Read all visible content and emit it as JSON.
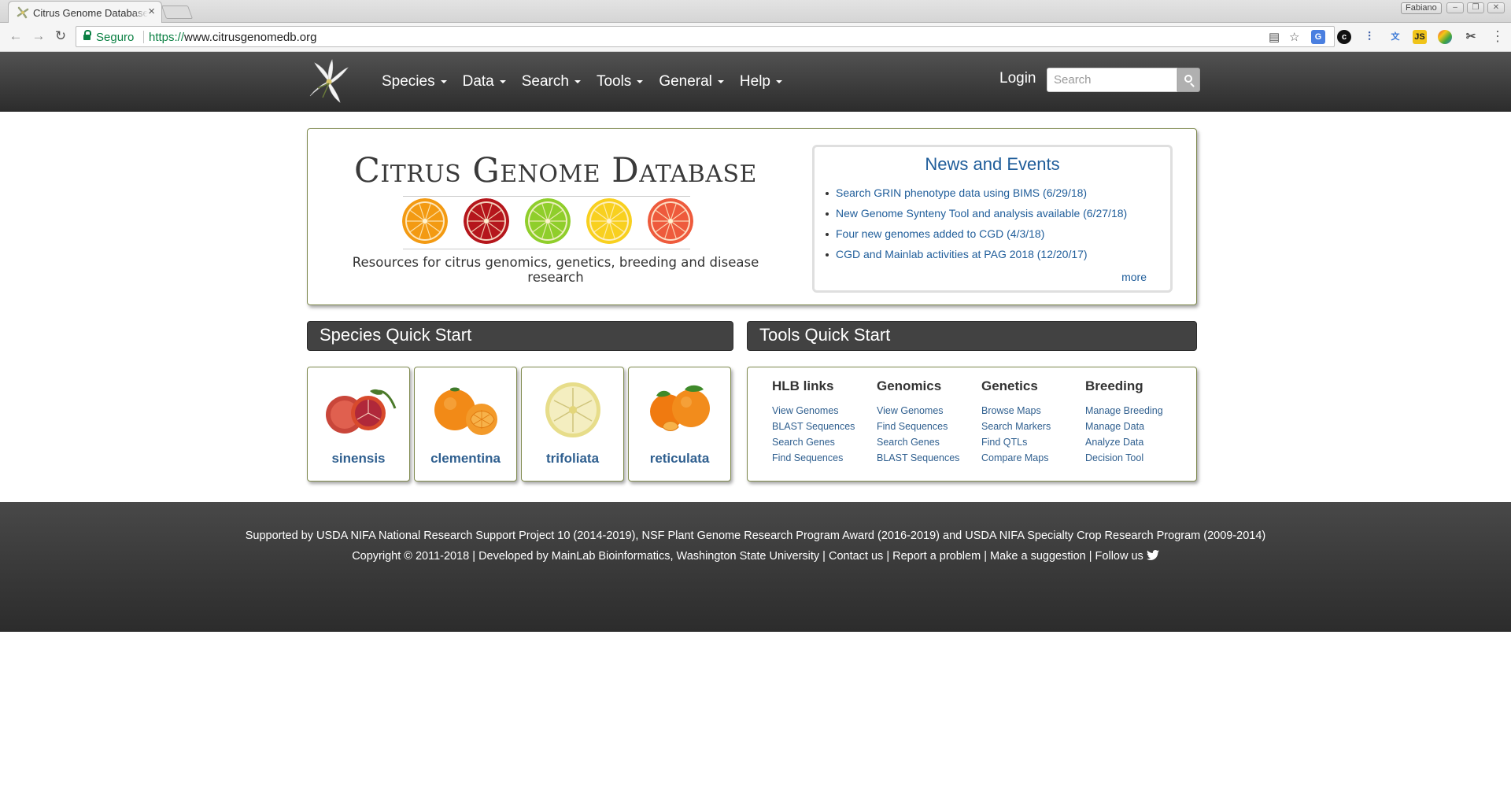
{
  "browser": {
    "tab_title": "Citrus Genome Database",
    "tab_close": "×",
    "profile_name": "Fabiano",
    "secure_label": "Seguro",
    "url_scheme": "https://",
    "url_host": "www.citrusgenomedb.org",
    "extensions": [
      "translate-icon",
      "chrome-extension-icon",
      "equalizer-icon",
      "google-translate-icon",
      "js-icon",
      "colorzilla-icon",
      "scissors-icon"
    ]
  },
  "nav": {
    "menu": [
      {
        "label": "Species"
      },
      {
        "label": "Data"
      },
      {
        "label": "Search"
      },
      {
        "label": "Tools"
      },
      {
        "label": "General"
      },
      {
        "label": "Help"
      }
    ],
    "login_label": "Login",
    "search_placeholder": "Search"
  },
  "hero": {
    "title": "Citrus Genome Database",
    "tagline": "Resources for citrus genomics, genetics, breeding and disease research",
    "slice_colors": [
      "#f39a12",
      "#b5161c",
      "#8fce2b",
      "#f8d01f",
      "#ee5a3c"
    ]
  },
  "news": {
    "title": "News and Events",
    "items": [
      "Search GRIN phenotype data using BIMS (6/29/18)",
      "New Genome Synteny Tool and analysis available (6/27/18)",
      "Four new genomes added to CGD (4/3/18)",
      "CGD and Mainlab activities at PAG 2018 (12/20/17)"
    ],
    "more_label": "more"
  },
  "species_qs": {
    "title": "Species Quick Start",
    "cards": [
      {
        "name": "sinensis"
      },
      {
        "name": "clementina"
      },
      {
        "name": "trifoliata"
      },
      {
        "name": "reticulata"
      }
    ]
  },
  "tools_qs": {
    "title": "Tools Quick Start",
    "columns": [
      {
        "heading": "HLB links",
        "links": [
          "View Genomes",
          "BLAST Sequences",
          "Search Genes",
          "Find Sequences"
        ]
      },
      {
        "heading": "Genomics",
        "links": [
          "View Genomes",
          "Find Sequences",
          "Search Genes",
          "BLAST Sequences"
        ]
      },
      {
        "heading": "Genetics",
        "links": [
          "Browse Maps",
          "Search Markers",
          "Find QTLs",
          "Compare Maps"
        ]
      },
      {
        "heading": "Breeding",
        "links": [
          "Manage Breeding",
          "Manage Data",
          "Analyze Data",
          "Decision Tool"
        ]
      }
    ]
  },
  "footer": {
    "support_text": "Supported by USDA NIFA National Research Support Project 10 (2014-2019), NSF Plant Genome Research Program Award (2016-2019) and USDA NIFA Specialty Crop Research Program (2009-2014)",
    "copyright": "Copyright © 2011-2018 | Developed by ",
    "mainlab_link": "MainLab Bioinformatics",
    "university": ", Washington State University | ",
    "contact_link": "Contact us",
    "sep": " | ",
    "report_link": "Report a problem",
    "suggest_link": "Make a suggestion",
    "follow_label": "Follow us"
  }
}
